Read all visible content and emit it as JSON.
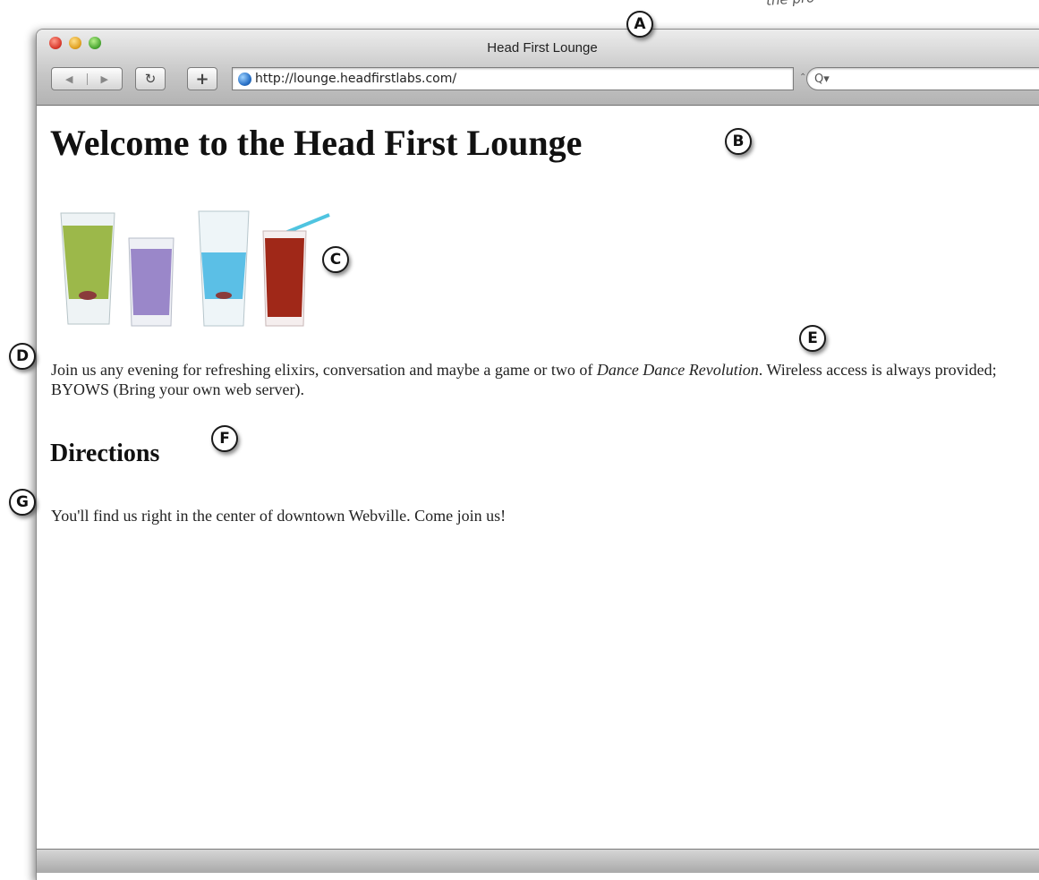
{
  "corner_text": "the pro",
  "window": {
    "title": "Head First Lounge",
    "url": "http://lounge.headfirstlabs.com/",
    "search_glyph": "Q▾"
  },
  "toolbar": {
    "back_glyph": "◀",
    "forward_glyph": "▶",
    "reload_glyph": "↻",
    "add_glyph": "+"
  },
  "page": {
    "heading": "Welcome to the Head First Lounge",
    "paragraph1_part1": "Join us any evening for refreshing elixirs, conversation and maybe a game or two of ",
    "paragraph1_em": "Dance Dance Revolution",
    "paragraph1_part2": ". Wireless access is always provided; BYOWS (Bring your own web server).",
    "subheading": "Directions",
    "paragraph2": "You'll find us right in the center of downtown Webville. Come join us!"
  },
  "drinks": [
    {
      "name": "green-drink",
      "color": "#9cb84a"
    },
    {
      "name": "purple-drink",
      "color": "#9a87c9"
    },
    {
      "name": "blue-drink",
      "color": "#5bbfe6"
    },
    {
      "name": "red-drink",
      "color": "#a02818"
    }
  ],
  "callouts": {
    "a": "A",
    "b": "B",
    "c": "C",
    "d": "D",
    "e": "E",
    "f": "F",
    "g": "G"
  }
}
